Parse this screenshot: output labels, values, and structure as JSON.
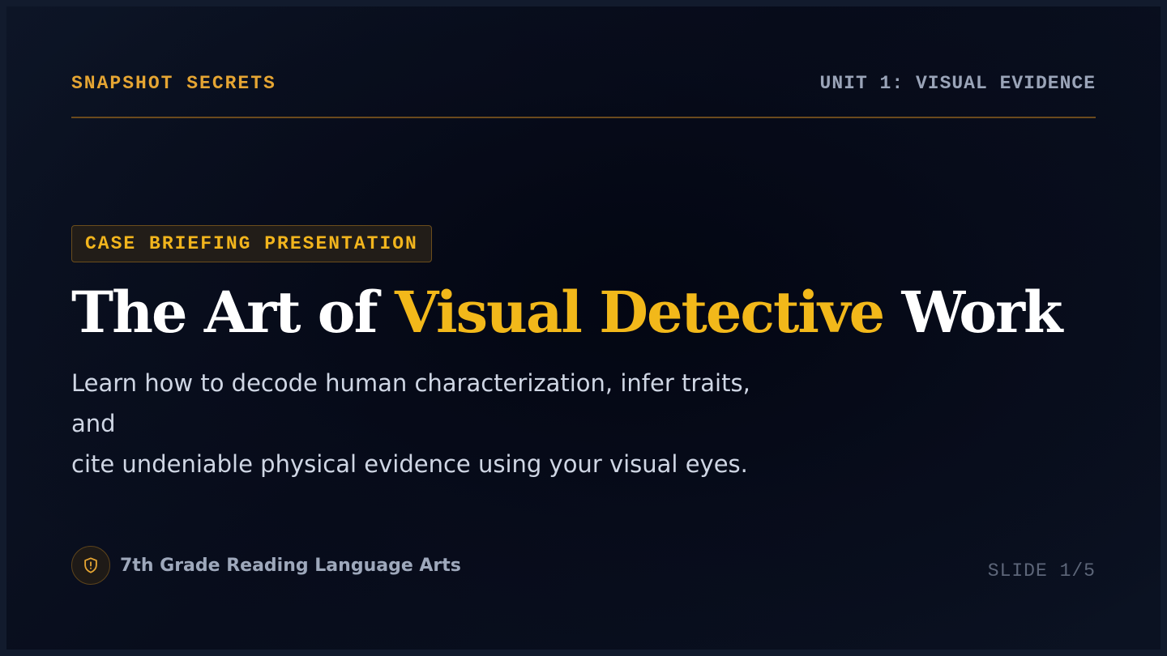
{
  "header": {
    "brand": "SNAPSHOT SECRETS",
    "unit": "UNIT 1: VISUAL EVIDENCE"
  },
  "badge": "CASE BRIEFING PRESENTATION",
  "title": {
    "before": "The Art of ",
    "highlight": "Visual Detective",
    "after": " Work"
  },
  "subtitle_line1": "Learn how to decode human characterization, infer traits, and",
  "subtitle_line2": "cite undeniable physical evidence using your visual eyes.",
  "footer": {
    "icon": "shield-alert-icon",
    "grade": "7th Grade Reading Language Arts",
    "slide": "SLIDE 1/5"
  },
  "colors": {
    "accent": "#f2b81a",
    "brand": "#e5a533",
    "background": "#080d1c",
    "text": "#ffffff",
    "muted": "#9aa4b8"
  }
}
